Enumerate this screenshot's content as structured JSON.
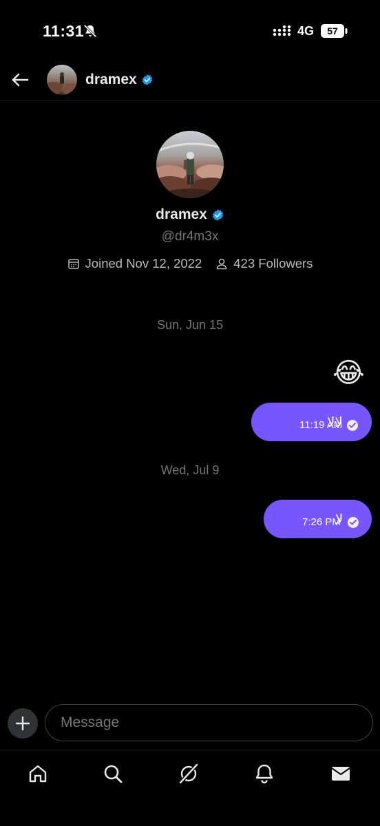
{
  "status_bar": {
    "time": "11:31",
    "network": "4G",
    "battery": "57",
    "icons": [
      "bell-off-icon",
      "signal-icon",
      "battery-icon"
    ]
  },
  "header": {
    "back_icon": "arrow-left-icon",
    "name": "dramex",
    "verified": true,
    "verified_color": "#1d9bf0"
  },
  "profile": {
    "name": "dramex",
    "handle": "@dr4m3x",
    "joined": "Joined Nov 12, 2022",
    "followers": "423 Followers"
  },
  "conversation": {
    "groups": [
      {
        "date": "Sun, Jun 15",
        "messages": [
          {
            "type": "emoji",
            "content": "😂"
          },
          {
            "type": "text",
            "content": "لالا",
            "time": "11:19 AM",
            "status": "read"
          }
        ]
      },
      {
        "date": "Wed, Jul 9",
        "messages": [
          {
            "type": "text",
            "content": "لا",
            "time": "7:26 PM",
            "status": "read"
          }
        ]
      }
    ]
  },
  "composer": {
    "placeholder": "Message",
    "value": ""
  },
  "bottom_nav": {
    "items": [
      "home-icon",
      "search-icon",
      "grok-icon",
      "notifications-icon",
      "messages-icon"
    ],
    "active": "messages-icon"
  },
  "colors": {
    "background": "#000000",
    "bubble": "#7856ff",
    "verified": "#1d9bf0",
    "muted_text": "#71767b"
  }
}
